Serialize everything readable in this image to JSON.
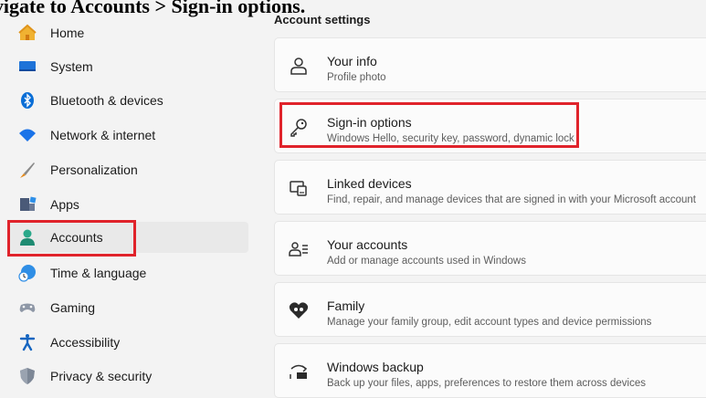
{
  "heading": "Navigate to Accounts > Sign-in options.",
  "sidebar": {
    "items": [
      {
        "label": "Home",
        "icon": "home-icon"
      },
      {
        "label": "System",
        "icon": "system-icon"
      },
      {
        "label": "Bluetooth & devices",
        "icon": "bluetooth-icon"
      },
      {
        "label": "Network & internet",
        "icon": "wifi-icon"
      },
      {
        "label": "Personalization",
        "icon": "brush-icon"
      },
      {
        "label": "Apps",
        "icon": "apps-icon"
      },
      {
        "label": "Accounts",
        "icon": "person-icon",
        "selected": true
      },
      {
        "label": "Time & language",
        "icon": "globe-clock-icon"
      },
      {
        "label": "Gaming",
        "icon": "gamepad-icon"
      },
      {
        "label": "Accessibility",
        "icon": "accessibility-icon"
      },
      {
        "label": "Privacy & security",
        "icon": "shield-icon"
      }
    ]
  },
  "main": {
    "section_title": "Account settings",
    "cards": [
      {
        "title": "Your info",
        "subtitle": "Profile photo",
        "icon": "person-outline-icon"
      },
      {
        "title": "Sign-in options",
        "subtitle": "Windows Hello, security key, password, dynamic lock",
        "icon": "key-icon",
        "highlighted": true
      },
      {
        "title": "Linked devices",
        "subtitle": "Find, repair, and manage devices that are signed in with your Microsoft account",
        "icon": "linked-devices-icon"
      },
      {
        "title": "Your accounts",
        "subtitle": "Add or manage accounts used in Windows",
        "icon": "accounts-list-icon"
      },
      {
        "title": "Family",
        "subtitle": "Manage your family group, edit account types and device permissions",
        "icon": "family-heart-icon"
      },
      {
        "title": "Windows backup",
        "subtitle": "Back up your files, apps, preferences to restore them across devices",
        "icon": "backup-icon"
      }
    ]
  },
  "colors": {
    "accent": "#0067c0",
    "highlight": "#e0232b",
    "selected_bg": "#e9e9e9"
  }
}
